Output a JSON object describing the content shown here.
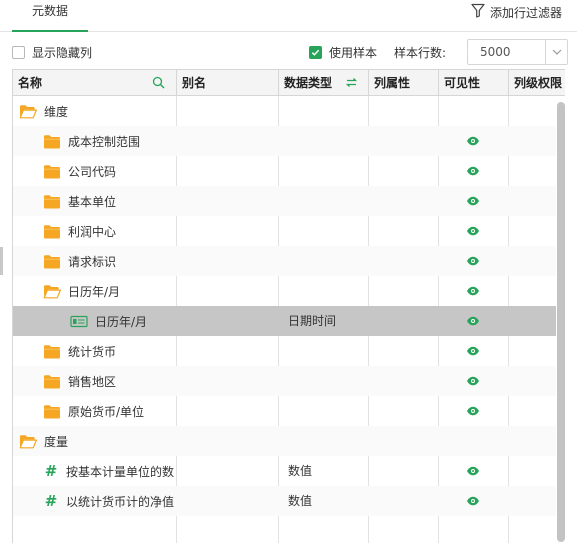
{
  "tabs": [
    {
      "label": "元数据",
      "active": true
    }
  ],
  "toolbar": {
    "add_filter_label": "添加行过滤器"
  },
  "options": {
    "show_hidden_label": "显示隐藏列",
    "show_hidden_checked": false,
    "use_sample_label": "使用样本",
    "use_sample_checked": true,
    "sample_rows_label": "样本行数:",
    "sample_rows_value": "5000"
  },
  "columns": {
    "name": "名称",
    "alias": "别名",
    "data_type": "数据类型",
    "column_property": "列属性",
    "visibility": "可见性",
    "column_permission": "列级权限"
  },
  "rows": [
    {
      "label": "维度",
      "type": "",
      "icon": "folder-open-icon",
      "visible": false,
      "selected": false
    },
    {
      "label": "成本控制范围",
      "type": "",
      "icon": "folder-icon",
      "visible": true,
      "selected": false
    },
    {
      "label": "公司代码",
      "type": "",
      "icon": "folder-icon",
      "visible": true,
      "selected": false
    },
    {
      "label": "基本单位",
      "type": "",
      "icon": "folder-icon",
      "visible": true,
      "selected": false
    },
    {
      "label": "利润中心",
      "type": "",
      "icon": "folder-icon",
      "visible": true,
      "selected": false
    },
    {
      "label": "请求标识",
      "type": "",
      "icon": "folder-icon",
      "visible": true,
      "selected": false
    },
    {
      "label": "日历年/月",
      "type": "",
      "icon": "folder-open-icon",
      "visible": true,
      "selected": false
    },
    {
      "label": "日历年/月",
      "type": "日期时间",
      "icon": "date-field-icon",
      "visible": true,
      "selected": true
    },
    {
      "label": "统计货币",
      "type": "",
      "icon": "folder-icon",
      "visible": true,
      "selected": false
    },
    {
      "label": "销售地区",
      "type": "",
      "icon": "folder-icon",
      "visible": true,
      "selected": false
    },
    {
      "label": "原始货币/单位",
      "type": "",
      "icon": "folder-icon",
      "visible": true,
      "selected": false
    },
    {
      "label": "度量",
      "type": "",
      "icon": "folder-open-icon",
      "visible": false,
      "selected": false
    },
    {
      "label": "按基本计量单位的数",
      "type": "数值",
      "icon": "hash-icon",
      "visible": true,
      "selected": false
    },
    {
      "label": "以统计货币计的净值",
      "type": "数值",
      "icon": "hash-icon",
      "visible": true,
      "selected": false
    }
  ],
  "colors": {
    "accent": "#27a35a",
    "folder": "#f5a623",
    "selected_row": "#c6c6c6"
  }
}
